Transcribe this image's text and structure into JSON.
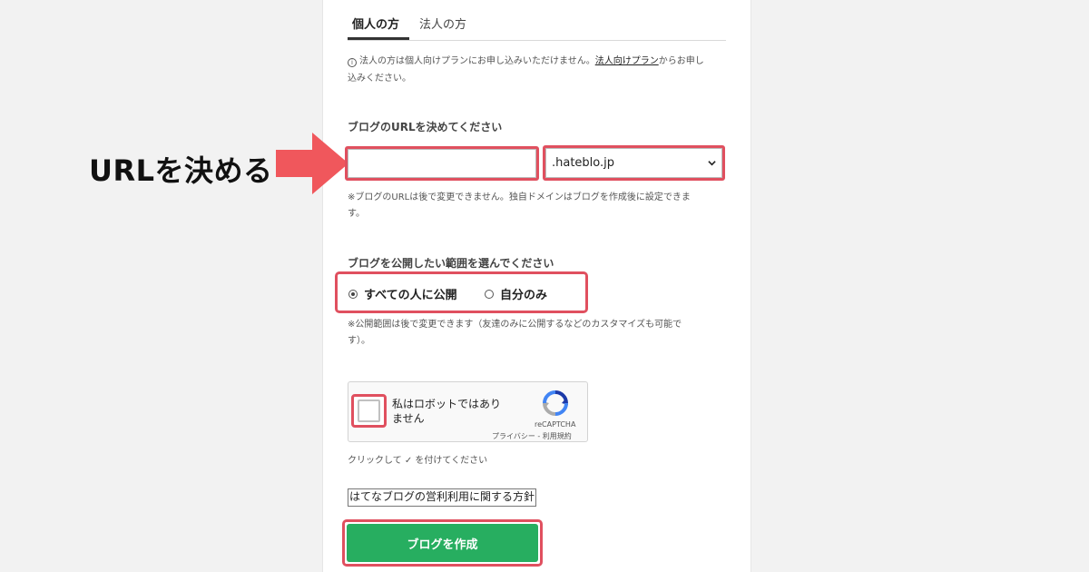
{
  "callout": {
    "label": "URLを決める"
  },
  "tabs": [
    {
      "label": "個人の方"
    },
    {
      "label": "法人の方"
    }
  ],
  "notice": {
    "icon": "info-icon",
    "text_before": "法人の方は個人向けプランにお申し込みいただけません。",
    "link_text": "法人向けプラン",
    "text_after_line1": "からお申し",
    "text_line2": "込みください。"
  },
  "url_section": {
    "title": "ブログのURLを決めてください",
    "input_value": "",
    "domain_selected": ".hateblo.jp",
    "hint_line1": "※ブログのURLは後で変更できません。独自ドメインはブログを作成後に設定できま",
    "hint_line2": "す。"
  },
  "visibility_section": {
    "title": "ブログを公開したい範囲を選んでください",
    "options": [
      {
        "label": "すべての人に公開",
        "checked": true
      },
      {
        "label": "自分のみ",
        "checked": false
      }
    ],
    "hint_line1": "※公開範囲は後で変更できます（友達のみに公開するなどのカスタマイズも可能で",
    "hint_line2": "す）。"
  },
  "recaptcha": {
    "label_line1": "私はロボットではあり",
    "label_line2": "ません",
    "brand": "reCAPTCHA",
    "links": "プライバシー - 利用規約",
    "instruction": "クリックして ✓ を付けてください"
  },
  "policy": {
    "link_text": "はてなブログの営利利用に関する方針"
  },
  "submit": {
    "label": "ブログを作成"
  },
  "colors": {
    "highlight": "#e0505f",
    "button": "#27ae60",
    "arrow": "#f0575c"
  }
}
